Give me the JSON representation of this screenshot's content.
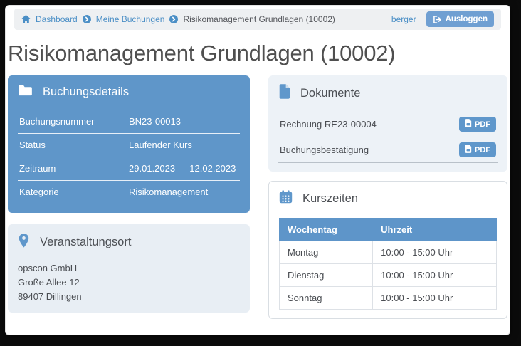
{
  "header": {
    "breadcrumbs": [
      {
        "label": "Dashboard"
      },
      {
        "label": "Meine Buchungen"
      },
      {
        "label": "Risikomanagement Grundlagen (10002)"
      }
    ],
    "user": "berger",
    "logout_label": "Ausloggen"
  },
  "page_title": "Risikomanagement Grundlagen (10002)",
  "booking_details": {
    "title": "Buchungsdetails",
    "rows": [
      {
        "label": "Buchungsnummer",
        "value": "BN23-00013"
      },
      {
        "label": "Status",
        "value": "Laufender Kurs"
      },
      {
        "label": "Zeitraum",
        "value": "29.01.2023 — 12.02.2023"
      },
      {
        "label": "Kategorie",
        "value": "Risikomanagement"
      }
    ]
  },
  "venue": {
    "title": "Veranstaltungsort",
    "address_lines": [
      "opscon GmbH",
      "Große Allee 12",
      "89407 Dillingen"
    ]
  },
  "documents": {
    "title": "Dokumente",
    "button_label": "PDF",
    "items": [
      {
        "label": "Rechnung RE23-00004"
      },
      {
        "label": "Buchungsbestätigung"
      }
    ]
  },
  "course_times": {
    "title": "Kurszeiten",
    "columns": [
      "Wochentag",
      "Uhrzeit"
    ],
    "rows": [
      {
        "day": "Montag",
        "time": "10:00 - 15:00 Uhr"
      },
      {
        "day": "Dienstag",
        "time": "10:00 - 15:00 Uhr"
      },
      {
        "day": "Sonntag",
        "time": "10:00 - 15:00 Uhr"
      }
    ]
  },
  "colors": {
    "accent_blue": "#5f96c9",
    "link_blue": "#4b8fc6",
    "light_card": "#e8eef4",
    "topbar_bg": "#eef0f2"
  }
}
